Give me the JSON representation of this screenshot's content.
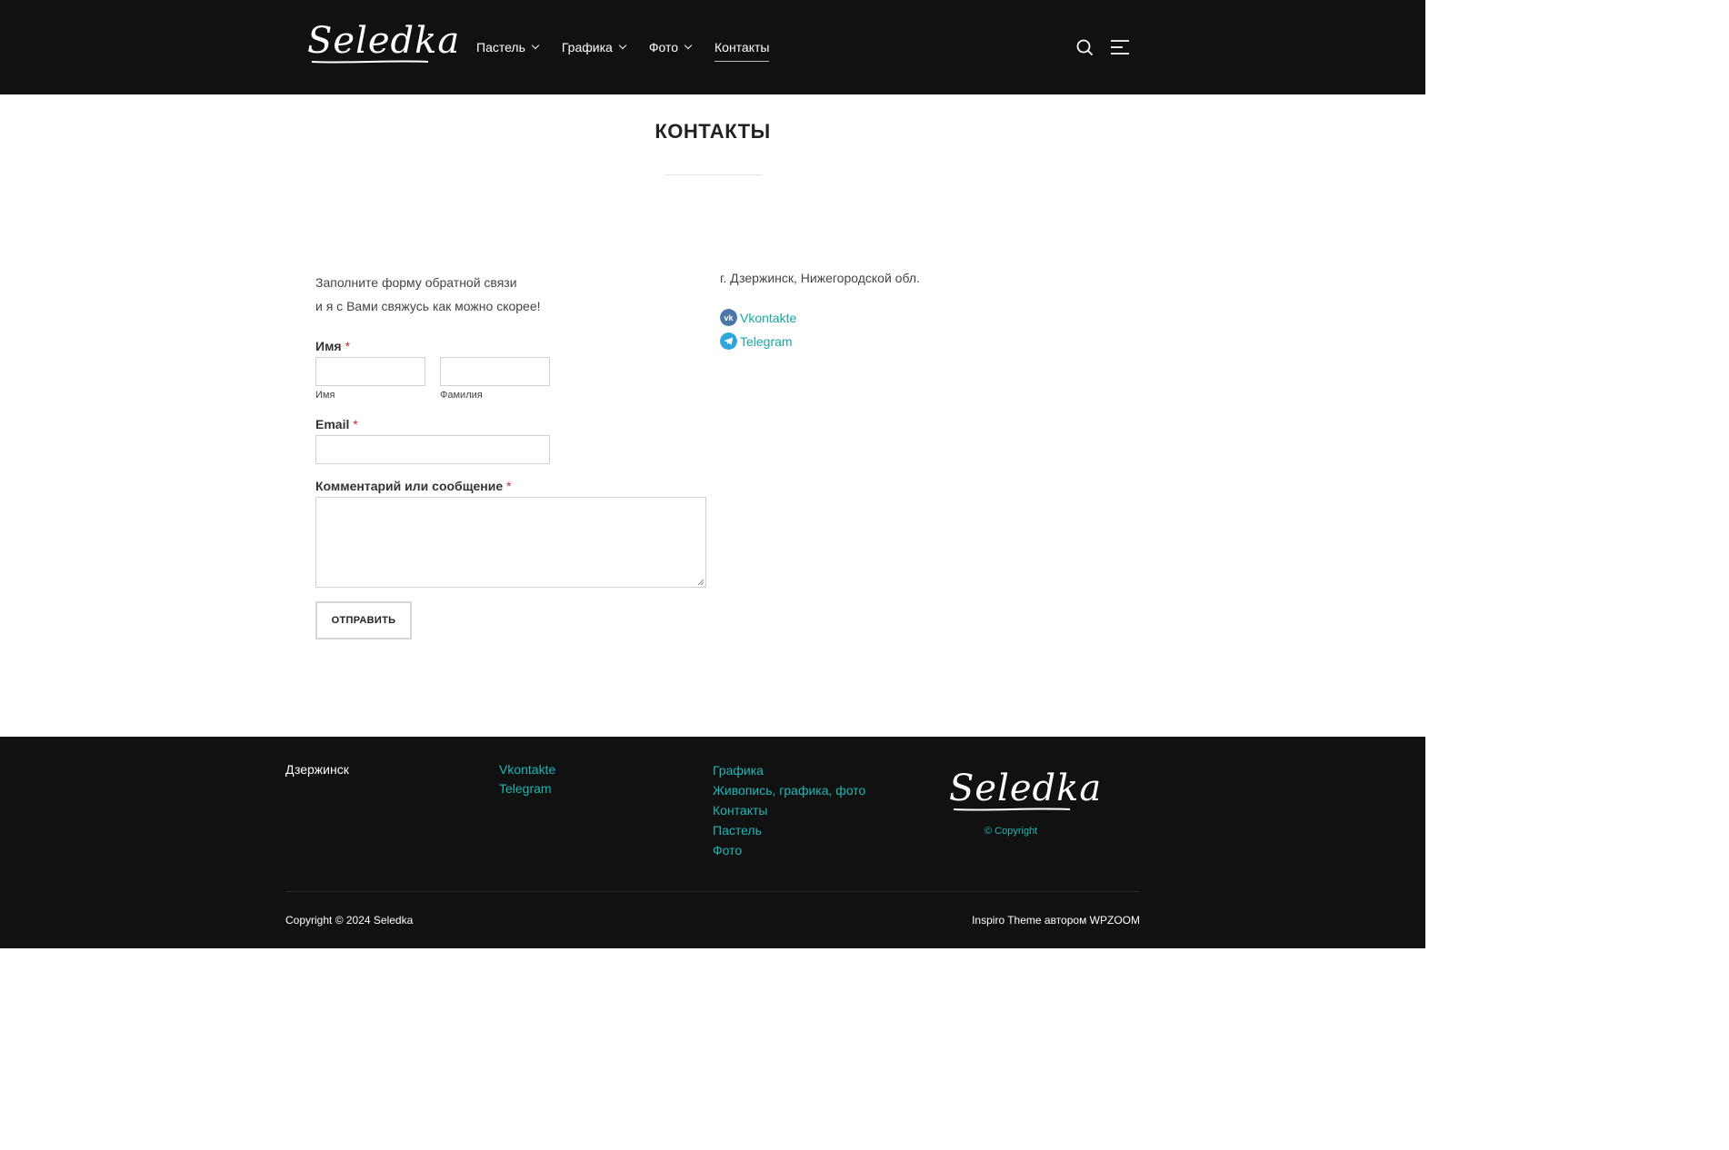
{
  "header": {
    "logo_text": "Seledka",
    "nav": [
      {
        "label": "Пастель",
        "has_dropdown": true
      },
      {
        "label": "Графика",
        "has_dropdown": true
      },
      {
        "label": "Фото",
        "has_dropdown": true
      },
      {
        "label": "Контакты",
        "has_dropdown": false,
        "active": true
      }
    ],
    "icons": [
      "search-icon",
      "menu-icon"
    ]
  },
  "page": {
    "title": "КОНТАКТЫ"
  },
  "form": {
    "intro_line1": "Заполните форму обратной связи",
    "intro_line2": "и я с Вами свяжусь как можно скорее!",
    "name_label": "Имя",
    "required_mark": "*",
    "first_name_sublabel": "Имя",
    "last_name_sublabel": "Фамилия",
    "first_name_value": "",
    "last_name_value": "",
    "email_label": "Email",
    "email_value": "",
    "message_label": "Комментарий или сообщение",
    "message_value": "",
    "submit_label": "ОТПРАВИТЬ"
  },
  "contact": {
    "address": "г. Дзержинск, Нижегородской обл.",
    "links": [
      {
        "label": "Vkontakte",
        "icon": "vk-icon"
      },
      {
        "label": "Telegram",
        "icon": "telegram-icon"
      }
    ]
  },
  "footer": {
    "city": "Дзержинск",
    "social_links": [
      "Vkontakte",
      "Telegram"
    ],
    "category_links": [
      "Графика",
      "Живопись, графика, фото",
      "Контакты",
      "Пастель",
      "Фото"
    ],
    "logo_text": "Seledka",
    "copyright_link": "© Copyright",
    "copyright": "Copyright © 2024 Seledka",
    "credit": "Inspiro Theme автором WPZOOM"
  },
  "colors": {
    "header_bg": "#111111",
    "accent": "#1fb7b7",
    "required": "#c02b2b",
    "vk_brand": "#4a76a8",
    "telegram_brand": "#2ea6db"
  }
}
